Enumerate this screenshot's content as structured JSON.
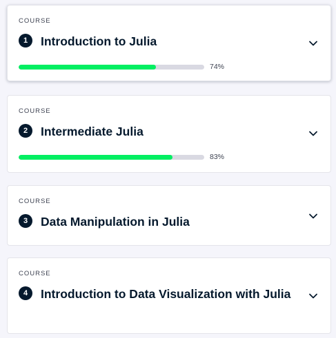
{
  "courses": [
    {
      "eyebrow": "COURSE",
      "number": "1",
      "title": "Introduction to Julia",
      "progress_label": "74%",
      "progress": 0.74
    },
    {
      "eyebrow": "COURSE",
      "number": "2",
      "title": "Intermediate Julia",
      "progress_label": "83%",
      "progress": 0.83
    },
    {
      "eyebrow": "COURSE",
      "number": "3",
      "title": "Data Manipulation in Julia"
    },
    {
      "eyebrow": "COURSE",
      "number": "4",
      "title": "Introduction to Data Visualization with Julia"
    }
  ],
  "icons": {
    "expand": "chevron-down-icon"
  },
  "colors": {
    "progress": "#03ef62",
    "badge": "#05192d",
    "text": "#05192d"
  }
}
